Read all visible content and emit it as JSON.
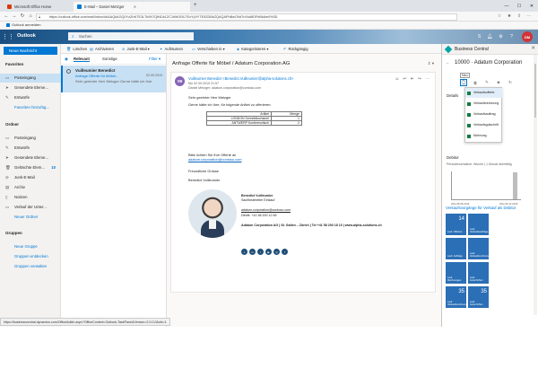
{
  "browser": {
    "tabs": [
      {
        "label": "Microsoft Office Home",
        "active": false
      },
      {
        "label": "E-Mail – Daniel Metzger",
        "active": true
      }
    ],
    "url": "https://outlook.office.com/mail/inbox/id/AAQkAGQ0YzZhNTE3LTk0NTQtNDk1ZC1hMGI5LTEzYjViYTE5ZDBkZQAQAPhBwO9dTn9Iu8fOFbBk6m0%3D",
    "favorites": "Outlook anmelden",
    "status_url": "https://businesscentral.dynamics.com/OfficeAddin.aspx?OfficeContext=Outlook-TaskPane&Version=2.0.0.0&ofc=1"
  },
  "outlook": {
    "app_title": "Outlook",
    "search_placeholder": "Suchen",
    "avatar_initials": "DM",
    "new_message": "Neue Nachricht",
    "commands": [
      "Löschen",
      "Archivieren",
      "Junk-E-Mail",
      "Aufräumen",
      "Verschieben in",
      "Kategorisieren",
      "Rückgängig"
    ],
    "favorites_header": "Favoriten",
    "folders_header": "Ordner",
    "groups_header": "Gruppen",
    "favorites": [
      {
        "label": "Posteingang",
        "count": "",
        "selected": true
      },
      {
        "label": "Gesendete Eleme...",
        "count": ""
      },
      {
        "label": "Entwürfe",
        "count": ""
      },
      {
        "label": "Favoriten hinzufüg...",
        "count": "",
        "link": true
      }
    ],
    "folders": [
      {
        "label": "Posteingang",
        "count": ""
      },
      {
        "label": "Entwürfe",
        "count": ""
      },
      {
        "label": "Gesendete Eleme...",
        "count": ""
      },
      {
        "label": "Gelöschte Elem...",
        "count": "10"
      },
      {
        "label": "Junk-E-Mail",
        "count": ""
      },
      {
        "label": "Archiv",
        "count": ""
      },
      {
        "label": "Notizen",
        "count": ""
      },
      {
        "label": "Verlauf der Unter...",
        "count": ""
      },
      {
        "label": "Neuer Ordner",
        "count": "",
        "link": true
      }
    ],
    "groups": [
      {
        "label": "Neue Gruppe",
        "link": true
      },
      {
        "label": "Gruppen entdecken",
        "link": true
      },
      {
        "label": "Gruppen verwalten",
        "link": true
      }
    ]
  },
  "list": {
    "tab_focused": "Relevant",
    "tab_other": "Sonstige",
    "filter": "Filter",
    "message": {
      "sender": "Vuilleumier Benedict",
      "subject": "Anfrage Offerte für Möbel...",
      "preview": "Sehr geehrter Herr Metzger Gerne hätte ich Ihre",
      "date": "02.09.2019"
    }
  },
  "reading": {
    "subject": "Anfrage Offerte für Möbel / Adatum Corporation AG",
    "avatar_initials": "VB",
    "from": "Vuilleumier Benedict <Benedict.Vuilleumier@alpha-solutions.ch>",
    "date": "Mo 02.09.2019 21:57",
    "to": "Daniel Metzger; adatum.corporation@contoso.com",
    "greeting": "Sehr geehrter Herr Metzger",
    "line1": "Gerne hätte ich Ihre, für folgende Artikel zu offerieren:",
    "table_headers": [
      "Artikel",
      "Menge"
    ],
    "table_rows": [
      [
        "LONDON Schreibtischstuhl",
        "1"
      ],
      [
        "ANTWERP Konferenztisch",
        "2"
      ]
    ],
    "line2": "Bitte richten Sie Ihre Offerte an",
    "link": "adatum.corporation@contoso.com",
    "closing": "Freundliche Grüsse",
    "signature_name": "Benedict Vuilleumier",
    "sig_bold_name": "Benedict Vuilleumier",
    "sig_title": "Sachbearbeiter Einkauf",
    "sig_email": "adatum.corporation@contoso.com",
    "sig_phone": "Direkt: +41 58 200 12 89",
    "sig_company": "Adatum Corporation AG | St. Gallen – Zürich | Tel +41 58 200 18 10 | www.alpha-solutions.ch"
  },
  "bc": {
    "title": "Business Central",
    "customer_id": "10000",
    "customer_name": "Adatum Corporation",
    "new_tooltip": "Neu",
    "dropdown": [
      "Verkaufsofferte",
      "Verkaufsrechnung",
      "Verkaufsauftrag",
      "Verkaufsgutschrift",
      "Mahnung"
    ],
    "section_details": "Details",
    "section_debitor": "Debitor",
    "chart_caption": "Periodenumsätze: Woche | 1 Monat überfällig",
    "axis_left": "Wtw-08.09.2019",
    "axis_right": "Wtw-06.10.2019",
    "activities_title": "Verkaufsvorgänge für Verkauf als Debitor",
    "tiles": [
      {
        "value": "14",
        "label": "Lauf. Offerten"
      },
      {
        "value": "",
        "label": "Lauf. Verkaufsaufträge"
      },
      {
        "value": "",
        "label": "Lauf. Aufträge"
      },
      {
        "value": "",
        "label": "Lauf. Verkaufsrechnungen"
      },
      {
        "value": "",
        "label": "Lauf. Rechnungen"
      },
      {
        "value": "",
        "label": "Lauf. Gutschriften"
      },
      {
        "value": "35",
        "label": "Lauf. Verkaufsrechnungen"
      },
      {
        "value": "35",
        "label": "Lauf. Gutschriften"
      }
    ]
  }
}
